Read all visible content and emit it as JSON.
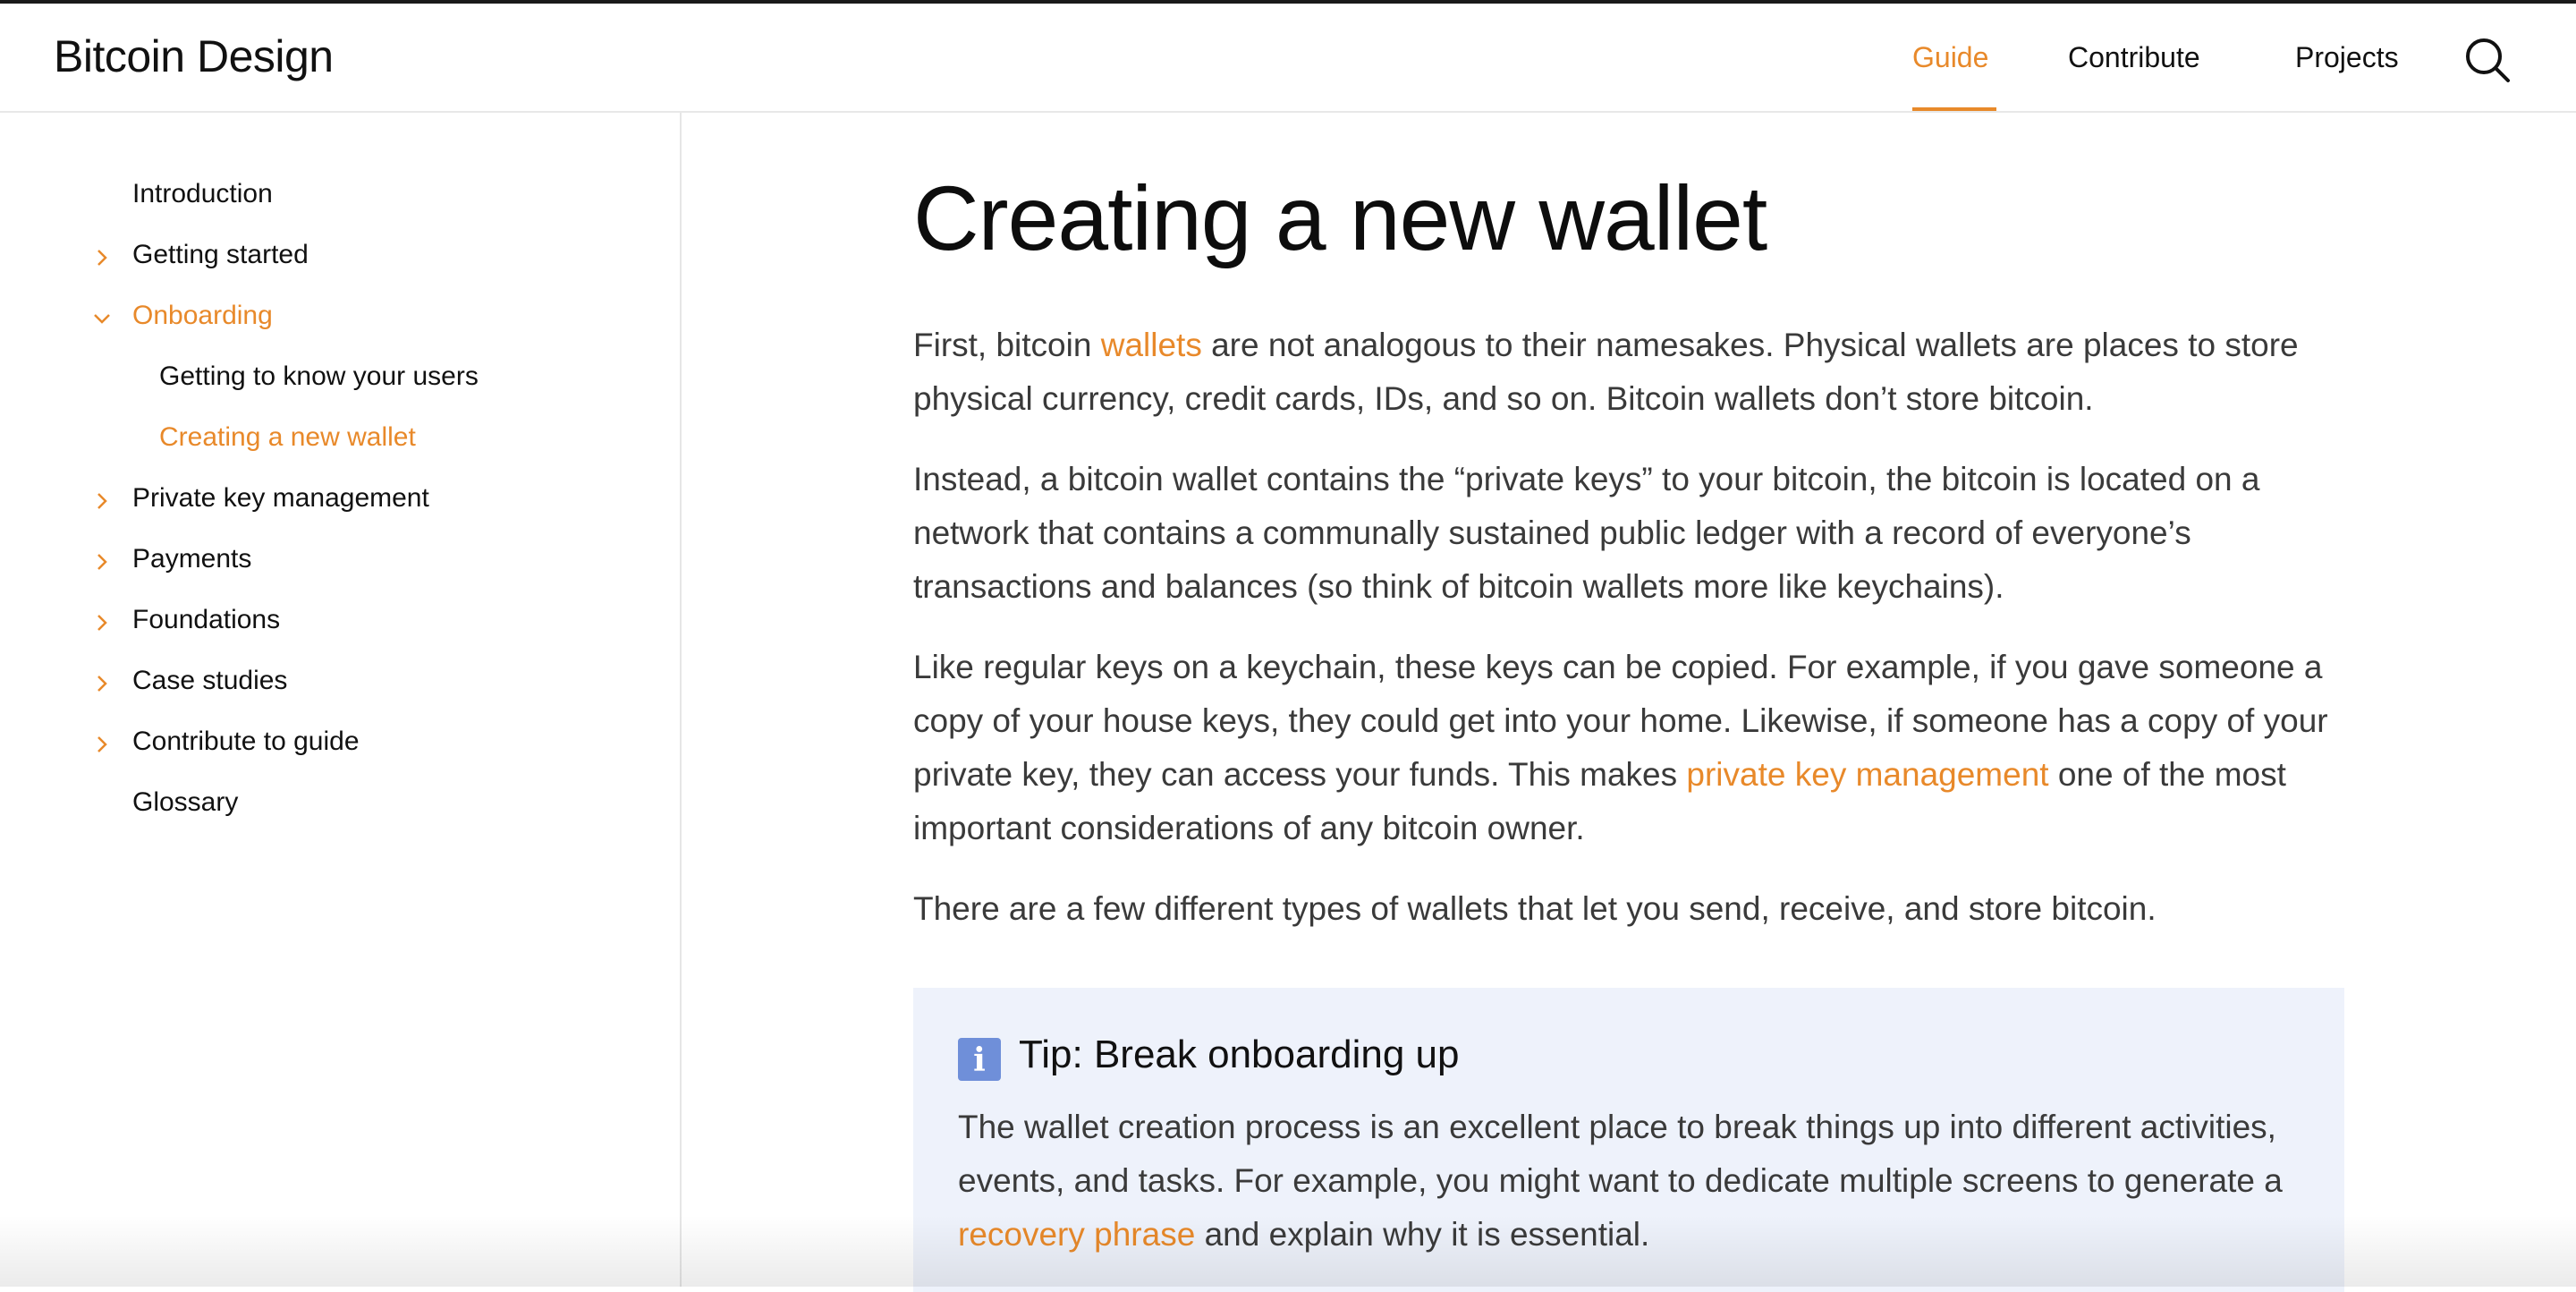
{
  "header": {
    "brand": "Bitcoin Design",
    "nav": [
      {
        "label": "Guide",
        "active": true
      },
      {
        "label": "Contribute",
        "active": false
      },
      {
        "label": "Projects",
        "active": false
      }
    ],
    "search_icon": "search-icon"
  },
  "sidebar": {
    "items": [
      {
        "label": "Introduction",
        "chevron": "none"
      },
      {
        "label": "Getting started",
        "chevron": "right"
      },
      {
        "label": "Onboarding",
        "chevron": "down",
        "active": true
      },
      {
        "label": "Getting to know your users",
        "chevron": "none",
        "sub": true
      },
      {
        "label": "Creating a new wallet",
        "chevron": "none",
        "sub": true,
        "active": true
      },
      {
        "label": "Private key management",
        "chevron": "right"
      },
      {
        "label": "Payments",
        "chevron": "right"
      },
      {
        "label": "Foundations",
        "chevron": "right"
      },
      {
        "label": "Case studies",
        "chevron": "right"
      },
      {
        "label": "Contribute to guide",
        "chevron": "right"
      },
      {
        "label": "Glossary",
        "chevron": "none"
      }
    ]
  },
  "main": {
    "title": "Creating a new wallet",
    "p1": {
      "a": "First, bitcoin ",
      "link": "wallets",
      "b": " are not analogous to their namesakes. Physical wallets are places to store physical currency, credit cards, IDs, and so on. Bitcoin wallets don’t store bitcoin."
    },
    "p2": "Instead, a bitcoin wallet contains the “private keys” to your bitcoin, the bitcoin is located on a network that contains a communally sustained public ledger with a record of everyone’s transactions and balances (so think of bitcoin wallets more like keychains).",
    "p3": {
      "a": "Like regular keys on a keychain, these keys can be copied. For example, if you gave someone a copy of your house keys, they could get into your home. Likewise, if someone has a copy of your private key, they can access your funds. This makes ",
      "link": "private key management",
      "b": " one of the most important considerations of any bitcoin owner."
    },
    "p4": "There are a few different types of wallets that let you send, receive, and store bitcoin.",
    "tip": {
      "icon_letter": "i",
      "title": "Tip: Break onboarding up",
      "a": "The wallet creation process is an excellent place to break things up into different activities, events, and tasks. For example, you might want to dedicate multiple screens to generate a ",
      "link": "recovery phrase",
      "b": " and explain why it is essential."
    }
  },
  "colors": {
    "accent": "#e8892a",
    "tip_bg": "#eef2fb",
    "tip_icon": "#6f8fd9"
  }
}
